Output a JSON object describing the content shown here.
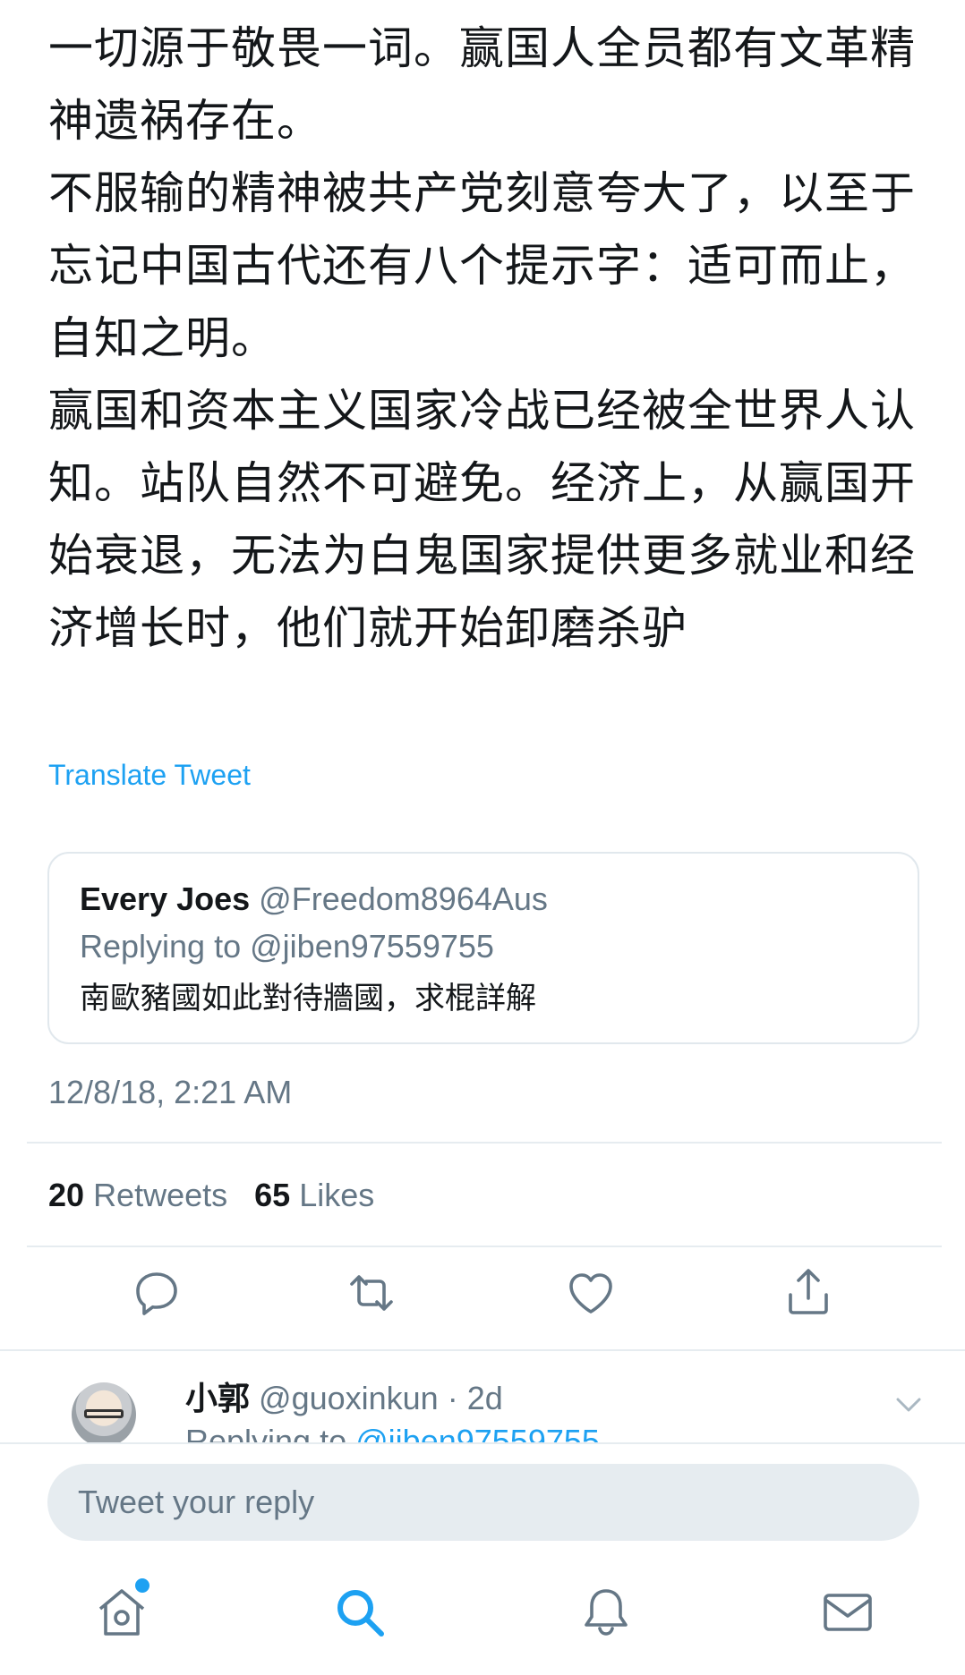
{
  "tweet": {
    "paragraphs": [
      "一切源于敬畏一词。赢国人全员都有文革精神遗祸存在。",
      "不服输的精神被共产党刻意夸大了，以至于忘记中国古代还有八个提示字：适可而止，自知之明。",
      "赢国和资本主义国家冷战已经被全世界人认知。站队自然不可避免。经济上，从赢国开始衰退，无法为白鬼国家提供更多就业和经济增长时，他们就开始卸磨杀驴"
    ],
    "translate_label": "Translate Tweet",
    "timestamp": "12/8/18, 2:21 AM"
  },
  "quoted_tweet": {
    "name": "Every Joes",
    "handle": "@Freedom8964Aus",
    "replying_prefix": "Replying to",
    "replying_handle": "@jiben97559755",
    "text": "南歐豬國如此對待牆國，求棍詳解"
  },
  "stats": {
    "retweets_count": "20",
    "retweets_label": "Retweets",
    "likes_count": "65",
    "likes_label": "Likes"
  },
  "actions": {
    "icons": [
      "reply-icon",
      "retweet-icon",
      "like-icon",
      "share-icon"
    ],
    "color": "#657786"
  },
  "reply_preview": {
    "name": "小郭",
    "handle": "@guoxinkun",
    "age": "· 2d",
    "replying_prefix": "Replying to",
    "replying_handle": "@jiben97559755"
  },
  "composer": {
    "placeholder": "Tweet your reply"
  },
  "tabbar": {
    "tabs": [
      "home-icon",
      "search-icon",
      "notifications-icon",
      "messages-icon"
    ],
    "active": "search-icon",
    "accent": "#1da1f2",
    "inactive_color": "#657786"
  }
}
